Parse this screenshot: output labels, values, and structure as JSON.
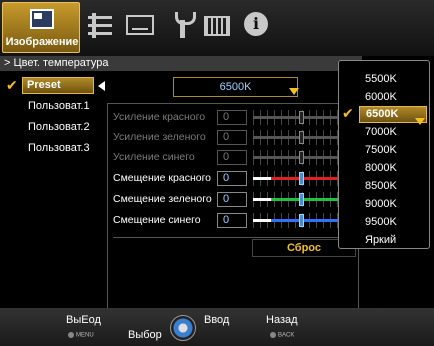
{
  "topbar": {
    "active_tab_label": "Изображение",
    "tabs": [
      {
        "name": "picture",
        "icon": "picture-icon"
      },
      {
        "name": "adjust",
        "icon": "adjust-icon"
      },
      {
        "name": "screen",
        "icon": "screen-icon"
      },
      {
        "name": "settings",
        "icon": "wrench-icon"
      },
      {
        "name": "keyboard",
        "icon": "grid-icon"
      },
      {
        "name": "info",
        "icon": "info-icon"
      }
    ],
    "info_glyph": "i"
  },
  "breadcrumb": "> Цвет. температура",
  "presets": {
    "selected": "Preset",
    "items": [
      "Пользоват.1",
      "Пользоват.2",
      "Пользоват.3"
    ]
  },
  "current_value": "6500K",
  "adjustments": [
    {
      "label": "Усиление красного",
      "value": "0",
      "enabled": false
    },
    {
      "label": "Усиление зеленого",
      "value": "0",
      "enabled": false
    },
    {
      "label": "Усиление синего",
      "value": "0",
      "enabled": false
    },
    {
      "label": "Смещение красного",
      "value": "0",
      "enabled": true,
      "color": "#e02020"
    },
    {
      "label": "Смещение зеленого",
      "value": "0",
      "enabled": true,
      "color": "#20c040"
    },
    {
      "label": "Смещение синего",
      "value": "0",
      "enabled": true,
      "color": "#3070ff"
    }
  ],
  "reset_label": "Сброс",
  "dropdown": {
    "items": [
      "5500K",
      "6000K",
      "6500K",
      "7000K",
      "7500K",
      "8000K",
      "8500K",
      "9000K",
      "9500K",
      "Яркий"
    ],
    "selected": "6500K"
  },
  "footer": {
    "exit_label": "ВыЕод",
    "exit_key": "MENU",
    "select_label": "Выбор",
    "enter_label": "Ввод",
    "back_label": "Назад",
    "back_key": "BACK"
  },
  "colors": {
    "accent_gold": "#b08a28",
    "highlight_yellow": "#f4c020",
    "value_blue": "#9ad4ff"
  }
}
